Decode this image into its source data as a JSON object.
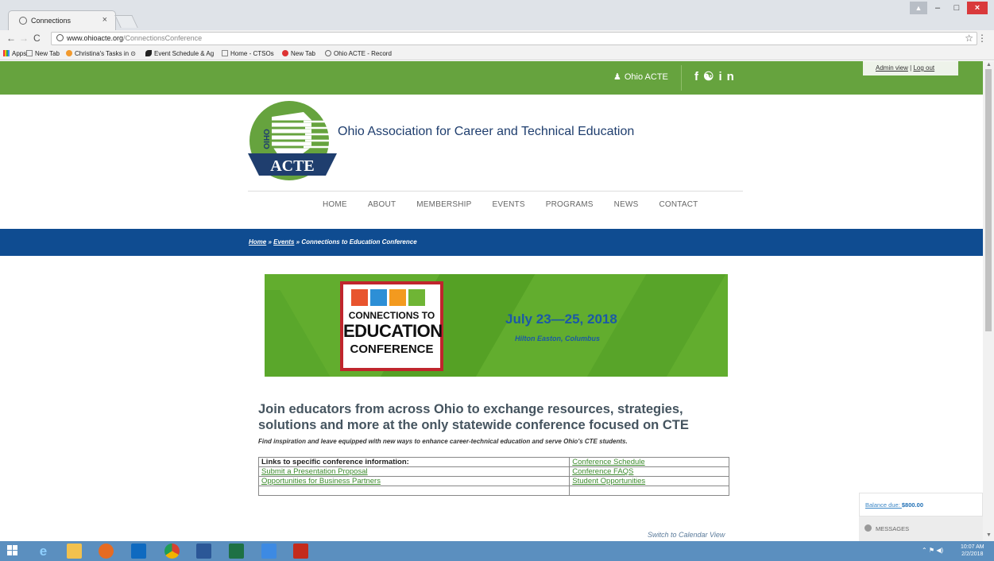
{
  "browser": {
    "tab_title": "Connections",
    "tab_close": "×",
    "url_host": "www.ohioacte.org",
    "url_path": "/ConnectionsConference",
    "back": "←",
    "forward": "→",
    "reload": "C",
    "star": "☆",
    "menu": "⋮",
    "min": "–",
    "max": "□",
    "close": "×",
    "user": "▲"
  },
  "bookmarks": [
    {
      "label": "Apps",
      "icon": "apps-icon"
    },
    {
      "label": "New Tab",
      "icon": "page-icon"
    },
    {
      "label": "Christina's Tasks in ⊙",
      "icon": "tasks-icon"
    },
    {
      "label": "Event Schedule & Ag",
      "icon": "event-icon"
    },
    {
      "label": "Home - CTSOs",
      "icon": "page-icon"
    },
    {
      "label": "New Tab",
      "icon": "red-icon"
    },
    {
      "label": "Ohio ACTE - Record",
      "icon": "globe-icon"
    }
  ],
  "topbar": {
    "account": "Ohio ACTE",
    "social": "f ♥ in",
    "admin_view": "Admin view",
    "separator": "|",
    "log_out": "Log out",
    "color": "#66a33e"
  },
  "site": {
    "title": "Ohio Association for Career and Technical Education",
    "logo_ohio": "OHIO",
    "logo_acte": "ACTE"
  },
  "nav": [
    "HOME",
    "ABOUT",
    "MEMBERSHIP",
    "EVENTS",
    "PROGRAMS",
    "NEWS",
    "CONTACT"
  ],
  "breadcrumb": {
    "home": "Home",
    "sep1": "»",
    "events": "Events",
    "sep2": "»",
    "current": "Connections to Education Conference"
  },
  "banner": {
    "line1": "CONNECTIONS TO",
    "line2": "EDUCATION",
    "line3": "CONFERENCE",
    "date": "July 23—25, 2018",
    "venue": "Hilton Easton, Columbus"
  },
  "content": {
    "headline": "Join educators from across Ohio to exchange resources, strategies, solutions and more at the only statewide conference focused on CTE",
    "subline": "Find inspiration and leave equipped with new ways to enhance career-technical education and serve Ohio's CTE students.",
    "table": {
      "header": "Links to specific conference information:",
      "rows": [
        [
          "",
          "Conference Schedule"
        ],
        [
          "Submit a Presentation Proposal",
          "Conference FAQS"
        ],
        [
          "Opportunities for Business Partners",
          "Student Opportunities"
        ],
        [
          "",
          ""
        ]
      ]
    },
    "calendar_link": "Switch to Calendar View"
  },
  "widget": {
    "balance_label": "Balance due: ",
    "balance_amount": "$800.00",
    "messages": "MESSAGES"
  },
  "taskbar": {
    "time": "10:07 AM",
    "date": "2/2/2018",
    "tray": "⌃ ⚑ ◀)"
  }
}
